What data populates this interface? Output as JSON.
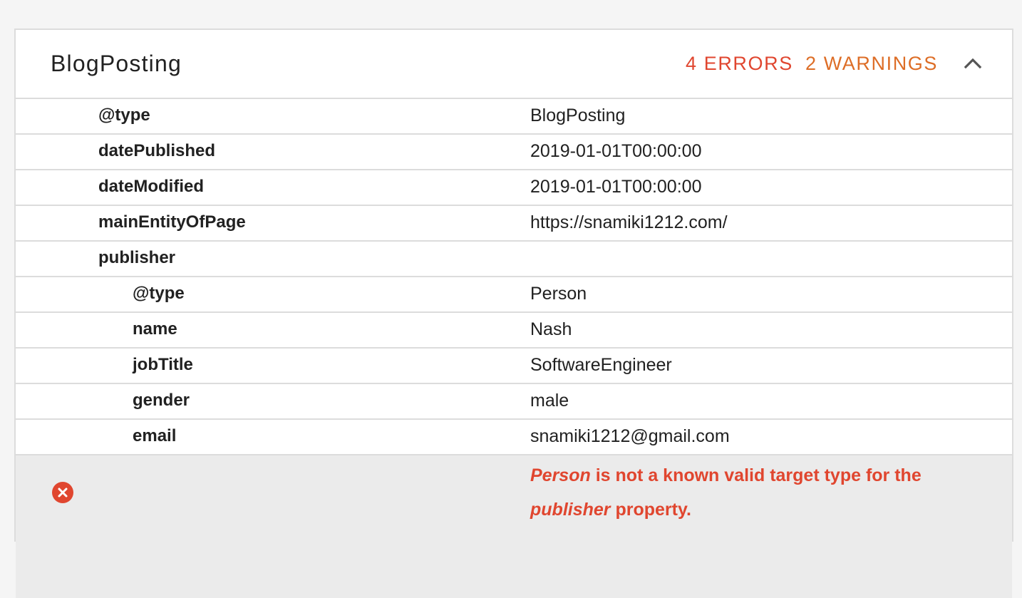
{
  "panel": {
    "title": "BlogPosting",
    "errors_label": "4 ERRORS",
    "warnings_label": "2 WARNINGS",
    "collapse_icon": "chevron-up-icon"
  },
  "rows": [
    {
      "key": "@type",
      "value": "BlogPosting",
      "level": 1
    },
    {
      "key": "datePublished",
      "value": "2019-01-01T00:00:00",
      "level": 1
    },
    {
      "key": "dateModified",
      "value": "2019-01-01T00:00:00",
      "level": 1
    },
    {
      "key": "mainEntityOfPage",
      "value": "https://snamiki1212.com/",
      "level": 1
    },
    {
      "key": "publisher",
      "value": "",
      "level": 1
    },
    {
      "key": "@type",
      "value": "Person",
      "level": 2
    },
    {
      "key": "name",
      "value": "Nash",
      "level": 2
    },
    {
      "key": "jobTitle",
      "value": "SoftwareEngineer",
      "level": 2
    },
    {
      "key": "gender",
      "value": "male",
      "level": 2
    },
    {
      "key": "email",
      "value": "snamiki1212@gmail.com",
      "level": 2
    }
  ],
  "error": {
    "icon": "error-circle-icon",
    "type_name": "Person",
    "text_mid": " is not a known valid target type for the ",
    "property_name": "publisher",
    "text_end": " property."
  },
  "colors": {
    "error": "#e0462f",
    "warning": "#dd6d26",
    "border": "#dcdcdc",
    "error_row_bg": "#ebebeb"
  }
}
